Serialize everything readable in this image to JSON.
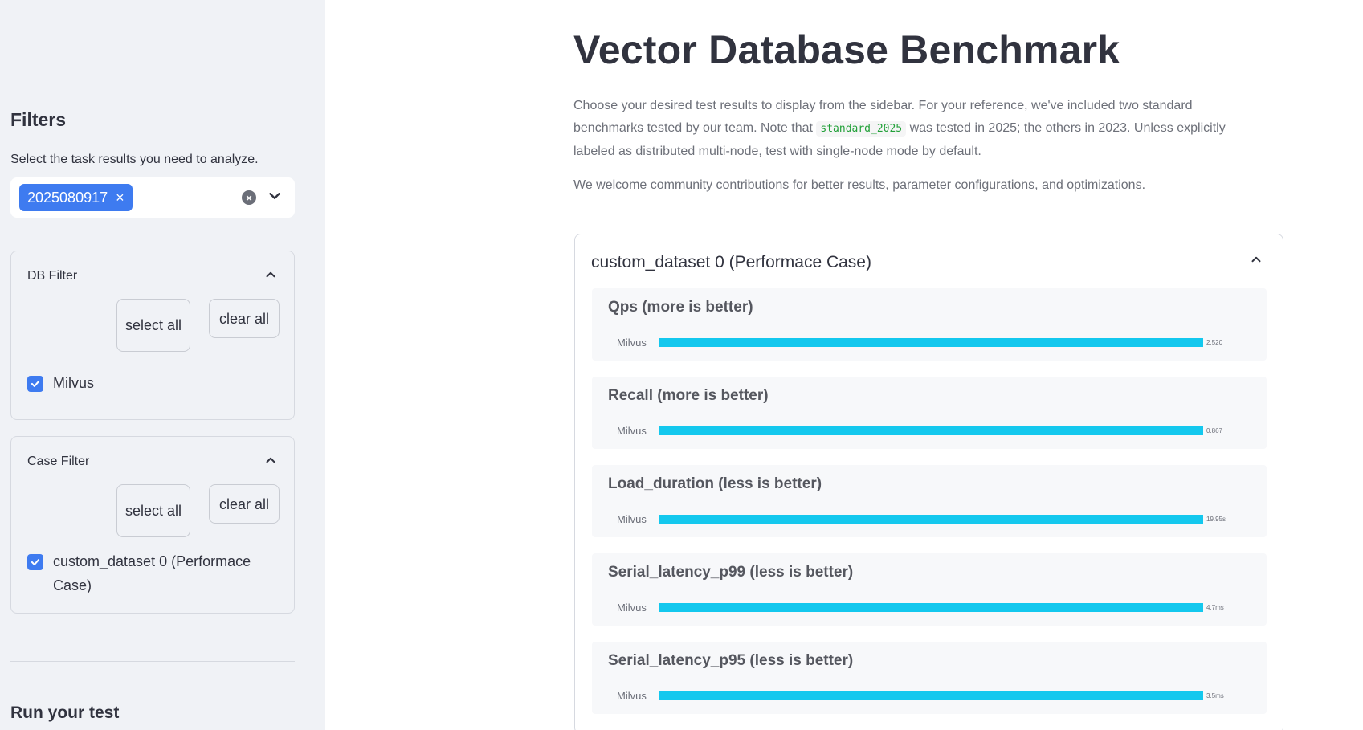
{
  "sidebar": {
    "title": "Filters",
    "description": "Select the task results you need to analyze.",
    "selected_task": "2025080917",
    "chip_remove": "×",
    "clear_icon": "×",
    "db_filter": {
      "title": "DB Filter",
      "select_all": "select all",
      "clear_all": "clear all",
      "options": [
        {
          "label": "Milvus",
          "checked": true
        }
      ]
    },
    "case_filter": {
      "title": "Case Filter",
      "select_all": "select all",
      "clear_all": "clear all",
      "options": [
        {
          "label": "custom_dataset 0 (Performace Case)",
          "checked": true
        }
      ]
    },
    "run_title": "Run your test"
  },
  "main": {
    "title": "Vector Database Benchmark",
    "intro_part1": "Choose your desired test results to display from the sidebar. For your reference, we've included two standard benchmarks tested by our team. Note that",
    "intro_code": "standard_2025",
    "intro_part2": "was tested in 2025; the others in 2023. Unless explicitly labeled as distributed multi-node, test with single-node mode by default.",
    "intro2": "We welcome community contributions for better results, parameter configurations, and optimizations.",
    "expander_title": "custom_dataset 0 (Performace Case)"
  },
  "chart_data": [
    {
      "type": "bar",
      "title": "Qps (more is better)",
      "categories": [
        "Milvus"
      ],
      "values": [
        2520
      ],
      "data_labels": [
        "2,520"
      ]
    },
    {
      "type": "bar",
      "title": "Recall (more is better)",
      "categories": [
        "Milvus"
      ],
      "values": [
        0.867
      ],
      "data_labels": [
        "0.867"
      ]
    },
    {
      "type": "bar",
      "title": "Load_duration (less is better)",
      "categories": [
        "Milvus"
      ],
      "values": [
        19.95
      ],
      "data_labels": [
        "19.95s"
      ]
    },
    {
      "type": "bar",
      "title": "Serial_latency_p99 (less is better)",
      "categories": [
        "Milvus"
      ],
      "values": [
        4.7
      ],
      "data_labels": [
        "4.7ms"
      ]
    },
    {
      "type": "bar",
      "title": "Serial_latency_p95 (less is better)",
      "categories": [
        "Milvus"
      ],
      "values": [
        3.5
      ],
      "data_labels": [
        "3.5ms"
      ]
    }
  ],
  "colors": {
    "accent": "#3e7bf0",
    "bar": "#14c8ee",
    "sidebar_bg": "#f0f2f6"
  }
}
